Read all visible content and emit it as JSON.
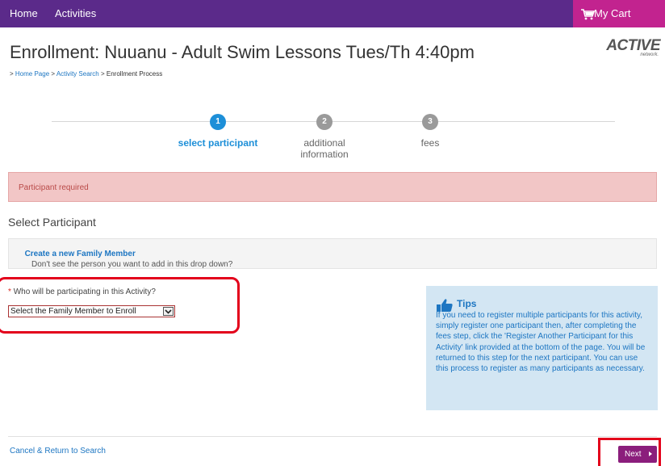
{
  "nav": {
    "home": "Home",
    "activities": "Activities",
    "cart": "My Cart"
  },
  "page_title": "Enrollment: Nuuanu - Adult Swim Lessons Tues/Th 4:40pm",
  "logo": {
    "brand": "ACTIVE",
    "sub": "network."
  },
  "breadcrumb": {
    "prefix": "> ",
    "home": "Home Page",
    "sep1": " > ",
    "search": "Activity Search",
    "sep2": " > ",
    "current": "Enrollment Process"
  },
  "steps": [
    {
      "number": "1",
      "label": "select participant",
      "active": true
    },
    {
      "number": "2",
      "label": "additional information",
      "active": false
    },
    {
      "number": "3",
      "label": "fees",
      "active": false
    }
  ],
  "colors": {
    "active_step": "#1d8fd8",
    "inactive_step": "#9a9a9a",
    "nav_bg": "#5b2a8a",
    "cart_bg": "#c2238f",
    "next_bg": "#8b1e7c",
    "highlight": "#e3001b"
  },
  "alert": "Participant required",
  "section_title": "Select Participant",
  "info": {
    "text": "Don't see the person you want to add in this drop down?",
    "link": "Create a new Family Member"
  },
  "question": {
    "required_mark": "*",
    "label": "Who will be participating in this Activity?"
  },
  "select": {
    "value": "Select the Family Member to Enroll"
  },
  "tips": {
    "title": "Tips",
    "body": "If you need to register multiple participants for this activity, simply register one participant then, after completing the fees step, click the 'Register Another Participant for this Activity' link provided at the bottom of the page. You will be returned to this step for the next participant. You can use this process to register as many participants as necessary."
  },
  "footer": {
    "cancel": "Cancel & Return to Search",
    "next": "Next"
  },
  "icons": [
    "cart-icon",
    "thumbs-up-icon",
    "chevron-down-icon",
    "play-arrow-icon"
  ]
}
